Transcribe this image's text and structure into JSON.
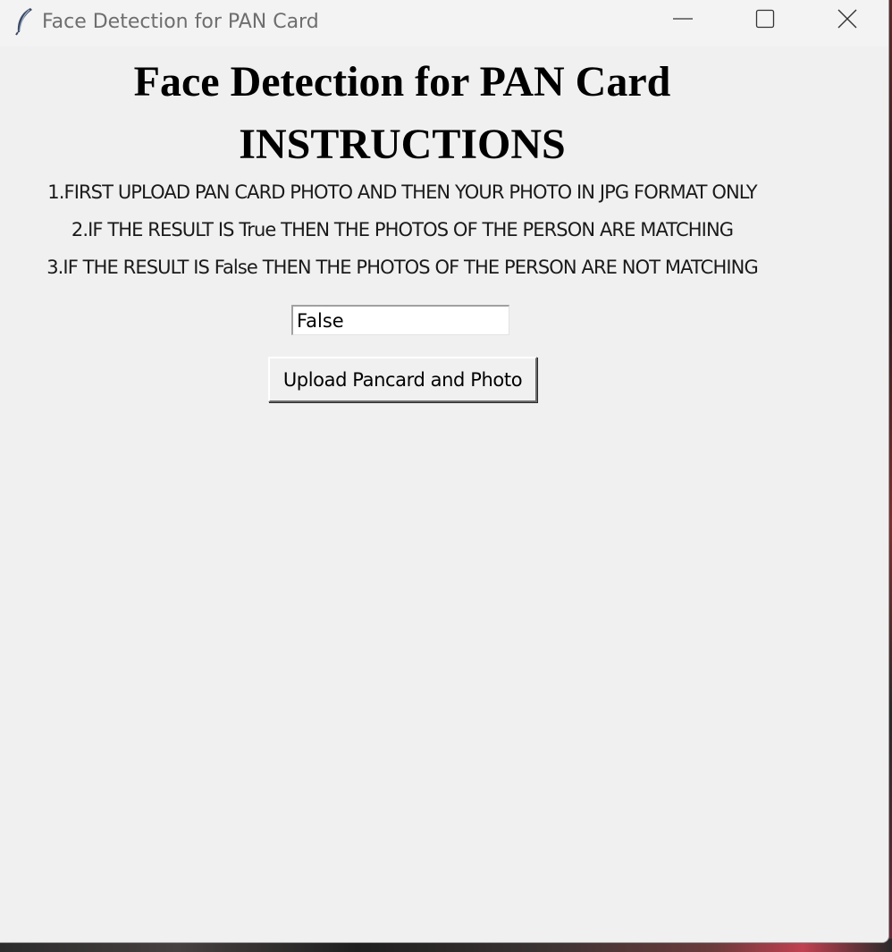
{
  "window": {
    "title": "Face Detection for PAN Card",
    "controls": {
      "minimize": "minimize-icon",
      "maximize": "maximize-icon",
      "close": "close-icon"
    },
    "app_icon": "feather-icon"
  },
  "main": {
    "heading": "Face Detection for PAN Card",
    "subheading": "INSTRUCTIONS",
    "instructions": [
      "1.FIRST UPLOAD PAN CARD PHOTO AND THEN YOUR PHOTO IN JPG FORMAT ONLY",
      "2.IF THE RESULT IS True THEN THE PHOTOS OF THE PERSON ARE MATCHING",
      "3.IF THE RESULT IS False THEN THE PHOTOS OF THE PERSON ARE NOT MATCHING"
    ],
    "result_value": "False",
    "upload_button_label": "Upload Pancard and Photo"
  },
  "colors": {
    "window_bg": "#f0f0f0",
    "title_text": "#6e6e6e",
    "text": "#000000"
  }
}
